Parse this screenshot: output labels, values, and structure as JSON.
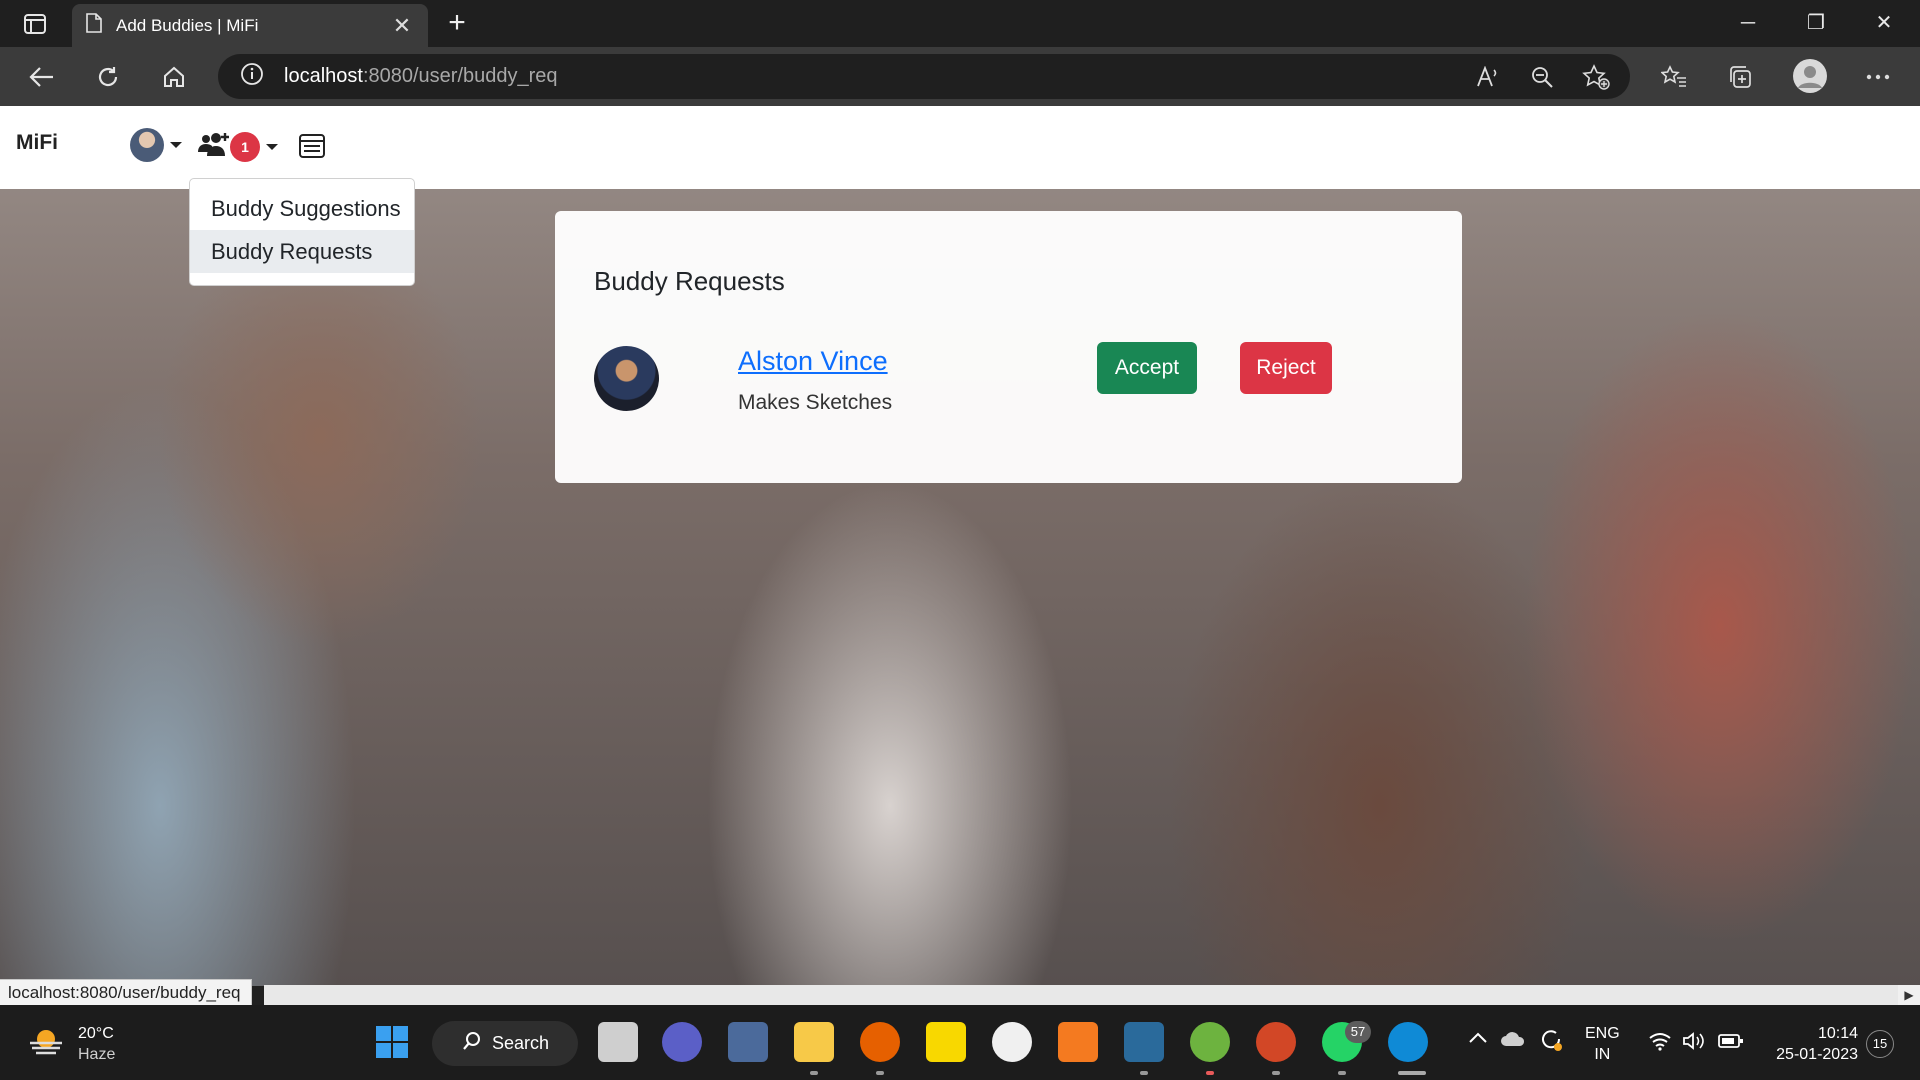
{
  "browser": {
    "tab_title": "Add Buddies | MiFi",
    "tab_close": "✕",
    "new_tab": "+",
    "url_host": "localhost",
    "url_rest": ":8080/user/buddy_req",
    "window_controls": [
      "─",
      "❐",
      "✕"
    ]
  },
  "app": {
    "brand": "MiFi",
    "buddy_badge_count": "1",
    "dropdown_items": [
      "Buddy Suggestions",
      "Buddy Requests"
    ],
    "active_dropdown_item": "Buddy Requests"
  },
  "card": {
    "title": "Buddy Requests",
    "request": {
      "name": "Alston Vince",
      "bio": "Makes Sketches",
      "accept_label": "Accept",
      "reject_label": "Reject"
    }
  },
  "status_bar": {
    "url": "localhost:8080/user/buddy_req"
  },
  "taskbar": {
    "weather_temp": "20°C",
    "weather_cond": "Haze",
    "search_label": "Search",
    "whatsapp_badge": "57",
    "lang_line1": "ENG",
    "lang_line2": "IN",
    "time": "10:14",
    "date": "25-01-2023",
    "notification_count": "15"
  },
  "colors": {
    "accept": "#198754",
    "reject": "#dc3545",
    "link": "#0d6efd",
    "badge": "#dc3545"
  }
}
